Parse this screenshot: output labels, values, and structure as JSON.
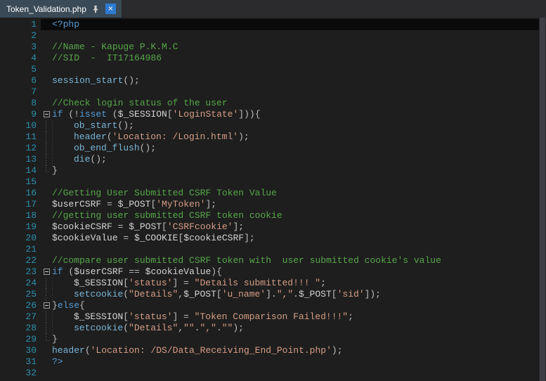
{
  "tab": {
    "title": "Token_Validation.php",
    "close_glyph": "×"
  },
  "icons": {
    "pin": "pushpin",
    "close": "×"
  },
  "colors": {
    "editor_bg": "#1e1e1e",
    "tabbar_bg": "#2b2b2e",
    "tab_bg": "#3a4a57",
    "tab_text": "#ffffff",
    "close_bg": "#2d7bd1",
    "line_number": "#2b91af",
    "keyword": "#569cd6",
    "function": "#79b6d8",
    "variable": "#d4d4d4",
    "string": "#d69d85",
    "comment": "#57a64a",
    "plain": "#bdbdbd",
    "current_line_bg": "#0a0a0a"
  },
  "editor": {
    "lines": [
      {
        "num": 1,
        "fold": null,
        "current": true,
        "tokens": [
          [
            "kw",
            "<?php"
          ]
        ]
      },
      {
        "num": 2,
        "fold": null,
        "current": false,
        "tokens": []
      },
      {
        "num": 3,
        "fold": null,
        "current": false,
        "tokens": [
          [
            "cm",
            "//Name - Kapuge P.K.M.C"
          ]
        ]
      },
      {
        "num": 4,
        "fold": null,
        "current": false,
        "tokens": [
          [
            "cm",
            "//SID  -  IT17164986"
          ]
        ]
      },
      {
        "num": 5,
        "fold": null,
        "current": false,
        "tokens": []
      },
      {
        "num": 6,
        "fold": null,
        "current": false,
        "tokens": [
          [
            "fn",
            "session_start"
          ],
          [
            "pl",
            "();"
          ]
        ]
      },
      {
        "num": 7,
        "fold": null,
        "current": false,
        "tokens": []
      },
      {
        "num": 8,
        "fold": null,
        "current": false,
        "tokens": [
          [
            "cm",
            "//Check login status of the user"
          ]
        ]
      },
      {
        "num": 9,
        "fold": "box",
        "current": false,
        "tokens": [
          [
            "kw",
            "if"
          ],
          [
            "pl",
            " (!"
          ],
          [
            "kw",
            "isset"
          ],
          [
            "pl",
            " ("
          ],
          [
            "var",
            "$_SESSION"
          ],
          [
            "pl",
            "["
          ],
          [
            "str",
            "'LoginState'"
          ],
          [
            "pl",
            "])){"
          ]
        ]
      },
      {
        "num": 10,
        "fold": "guide",
        "current": false,
        "tokens": [
          [
            "ind",
            ""
          ],
          [
            "fn",
            "ob_start"
          ],
          [
            "pl",
            "();"
          ]
        ]
      },
      {
        "num": 11,
        "fold": "guide",
        "current": false,
        "tokens": [
          [
            "ind",
            ""
          ],
          [
            "fn",
            "header"
          ],
          [
            "pl",
            "("
          ],
          [
            "str",
            "'Location: /Login.html'"
          ],
          [
            "pl",
            ");"
          ]
        ]
      },
      {
        "num": 12,
        "fold": "guide",
        "current": false,
        "tokens": [
          [
            "ind",
            ""
          ],
          [
            "fn",
            "ob_end_flush"
          ],
          [
            "pl",
            "();"
          ]
        ]
      },
      {
        "num": 13,
        "fold": "guide",
        "current": false,
        "tokens": [
          [
            "ind",
            ""
          ],
          [
            "fn",
            "die"
          ],
          [
            "pl",
            "();"
          ]
        ]
      },
      {
        "num": 14,
        "fold": "end",
        "current": false,
        "tokens": [
          [
            "pl",
            "}"
          ]
        ]
      },
      {
        "num": 15,
        "fold": null,
        "current": false,
        "tokens": []
      },
      {
        "num": 16,
        "fold": null,
        "current": false,
        "tokens": [
          [
            "cm",
            "//Getting User Submitted CSRF Token Value"
          ]
        ]
      },
      {
        "num": 17,
        "fold": null,
        "current": false,
        "tokens": [
          [
            "var",
            "$userCSRF"
          ],
          [
            "pl",
            " = "
          ],
          [
            "var",
            "$_POST"
          ],
          [
            "pl",
            "["
          ],
          [
            "str",
            "'MyToken'"
          ],
          [
            "pl",
            "];"
          ]
        ]
      },
      {
        "num": 18,
        "fold": null,
        "current": false,
        "tokens": [
          [
            "cm",
            "//getting user submitted CSRF token cookie"
          ]
        ]
      },
      {
        "num": 19,
        "fold": null,
        "current": false,
        "tokens": [
          [
            "var",
            "$cookieCSRF"
          ],
          [
            "pl",
            " = "
          ],
          [
            "var",
            "$_POST"
          ],
          [
            "pl",
            "["
          ],
          [
            "str",
            "'CSRFcookie'"
          ],
          [
            "pl",
            "];"
          ]
        ]
      },
      {
        "num": 20,
        "fold": null,
        "current": false,
        "tokens": [
          [
            "var",
            "$cookieValue"
          ],
          [
            "pl",
            " = "
          ],
          [
            "var",
            "$_COOKIE"
          ],
          [
            "pl",
            "["
          ],
          [
            "var",
            "$cookieCSRF"
          ],
          [
            "pl",
            "];"
          ]
        ]
      },
      {
        "num": 21,
        "fold": null,
        "current": false,
        "tokens": []
      },
      {
        "num": 22,
        "fold": null,
        "current": false,
        "tokens": [
          [
            "cm",
            "//compare user submitted CSRF token with  user submitted cookie's value"
          ]
        ]
      },
      {
        "num": 23,
        "fold": "box",
        "current": false,
        "tokens": [
          [
            "kw",
            "if"
          ],
          [
            "pl",
            " ("
          ],
          [
            "var",
            "$userCSRF"
          ],
          [
            "pl",
            " == "
          ],
          [
            "var",
            "$cookieValue"
          ],
          [
            "pl",
            "){"
          ]
        ]
      },
      {
        "num": 24,
        "fold": "guide",
        "current": false,
        "tokens": [
          [
            "ind",
            ""
          ],
          [
            "var",
            "$_SESSION"
          ],
          [
            "pl",
            "["
          ],
          [
            "str",
            "'status'"
          ],
          [
            "pl",
            "] = "
          ],
          [
            "str",
            "\"Details submitted!!! \""
          ],
          [
            "pl",
            ";"
          ]
        ]
      },
      {
        "num": 25,
        "fold": "guide",
        "current": false,
        "tokens": [
          [
            "ind",
            ""
          ],
          [
            "fn",
            "setcookie"
          ],
          [
            "pl",
            "("
          ],
          [
            "str",
            "\"Details\""
          ],
          [
            "pl",
            ","
          ],
          [
            "var",
            "$_POST"
          ],
          [
            "pl",
            "["
          ],
          [
            "str",
            "'u_name'"
          ],
          [
            "pl",
            "]."
          ],
          [
            "str",
            "\",\""
          ],
          [
            "pl",
            "."
          ],
          [
            "var",
            "$_POST"
          ],
          [
            "pl",
            "["
          ],
          [
            "str",
            "'sid'"
          ],
          [
            "pl",
            "]);"
          ]
        ]
      },
      {
        "num": 26,
        "fold": "box",
        "current": false,
        "tokens": [
          [
            "pl",
            "}"
          ],
          [
            "kw",
            "else"
          ],
          [
            "pl",
            "{"
          ]
        ]
      },
      {
        "num": 27,
        "fold": "guide",
        "current": false,
        "tokens": [
          [
            "ind",
            ""
          ],
          [
            "var",
            "$_SESSION"
          ],
          [
            "pl",
            "["
          ],
          [
            "str",
            "'status'"
          ],
          [
            "pl",
            "] = "
          ],
          [
            "str",
            "\"Token Comparison Failed!!!\""
          ],
          [
            "pl",
            ";"
          ]
        ]
      },
      {
        "num": 28,
        "fold": "guide",
        "current": false,
        "tokens": [
          [
            "ind",
            ""
          ],
          [
            "fn",
            "setcookie"
          ],
          [
            "pl",
            "("
          ],
          [
            "str",
            "\"Details\""
          ],
          [
            "pl",
            ","
          ],
          [
            "str",
            "\"\""
          ],
          [
            "pl",
            "."
          ],
          [
            "str",
            "\",\""
          ],
          [
            "pl",
            "."
          ],
          [
            "str",
            "\"\""
          ],
          [
            "pl",
            ");"
          ]
        ]
      },
      {
        "num": 29,
        "fold": "end",
        "current": false,
        "tokens": [
          [
            "pl",
            "}"
          ]
        ]
      },
      {
        "num": 30,
        "fold": null,
        "current": false,
        "tokens": [
          [
            "fn",
            "header"
          ],
          [
            "pl",
            "("
          ],
          [
            "str",
            "'Location: /DS/Data_Receiving_End_Point.php'"
          ],
          [
            "pl",
            ");"
          ]
        ]
      },
      {
        "num": 31,
        "fold": null,
        "current": false,
        "tokens": [
          [
            "kw",
            "?>"
          ]
        ]
      },
      {
        "num": 32,
        "fold": null,
        "current": false,
        "tokens": []
      }
    ]
  }
}
